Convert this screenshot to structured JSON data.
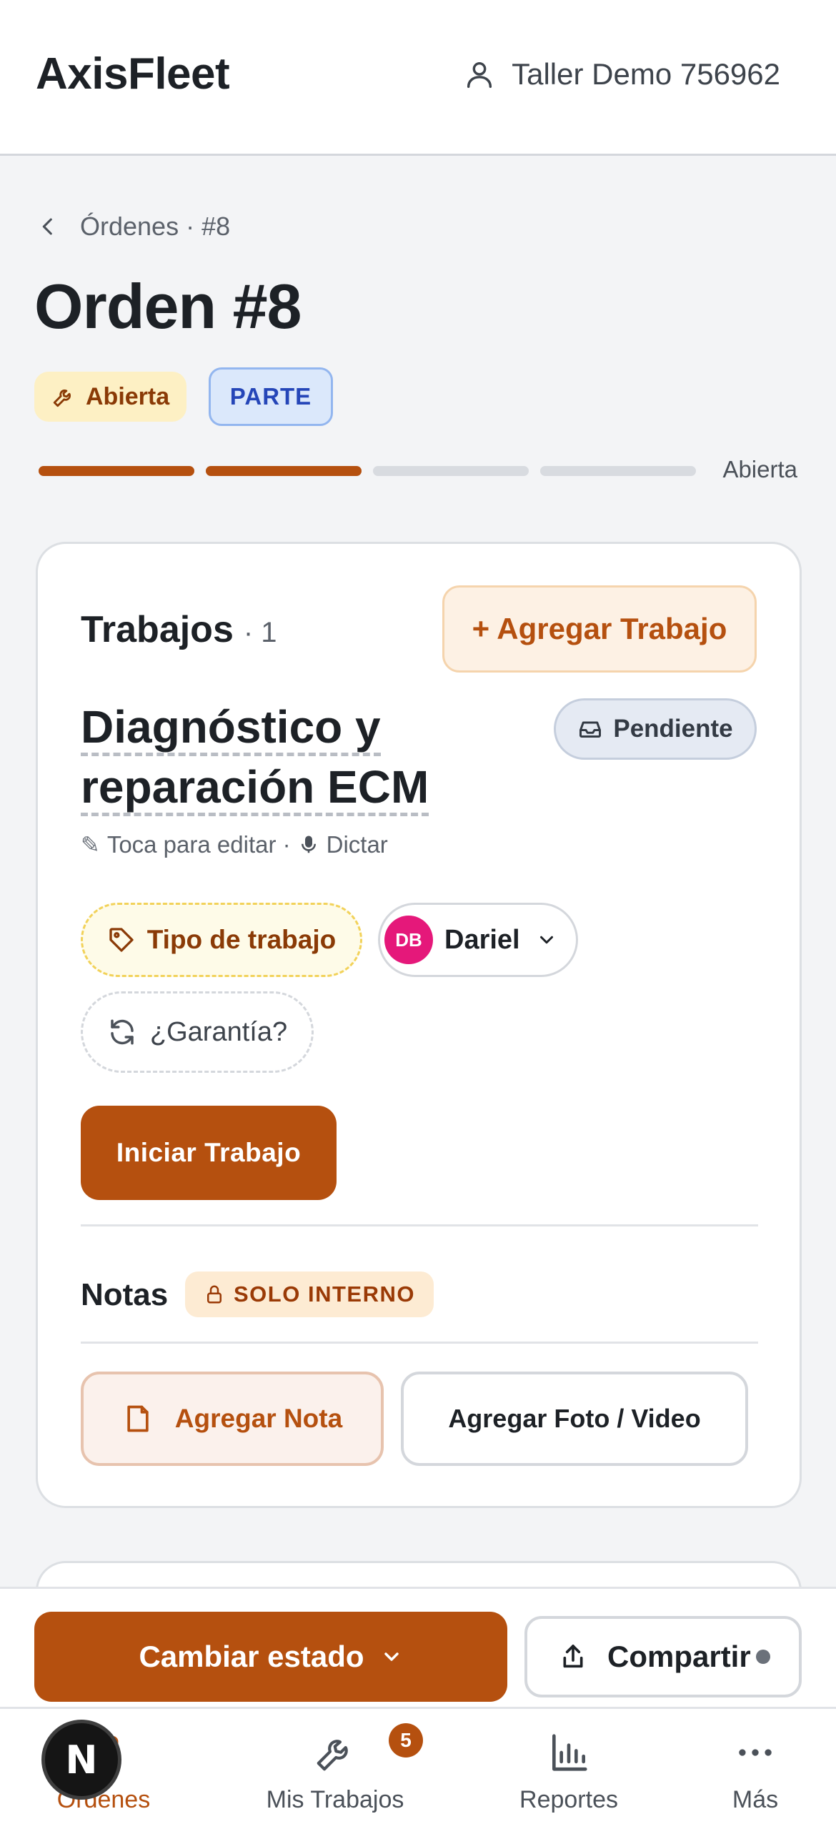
{
  "header": {
    "brand": "AxisFleet",
    "user_name": "Taller Demo 756962",
    "icons": {
      "user": "user-icon"
    }
  },
  "breadcrumb": {
    "text": "Órdenes · #8",
    "back_icon": "chevron-left-icon"
  },
  "order": {
    "title": "Orden #8",
    "status_badge": "Abierta",
    "type_badge": "PARTE",
    "progress": {
      "completed_steps": 2,
      "total_steps": 4,
      "label": "Abierta"
    }
  },
  "jobs": {
    "heading": "Trabajos",
    "count": "· 1",
    "add_button": "+ Agregar Trabajo",
    "item": {
      "title": "Diagnóstico y reparación ECM",
      "status": "Pendiente",
      "hint_edit": "Toca para editar ·",
      "hint_dictate": "Dictar",
      "job_type_label": "Tipo de trabajo",
      "assignee_initials": "DB",
      "assignee_name": "Dariel",
      "warranty_label": "¿Garantía?",
      "start_button": "Iniciar Trabajo"
    },
    "notes": {
      "heading": "Notas",
      "internal_badge": "SOLO INTERNO",
      "add_note_button": "Agregar Nota",
      "add_media_button": "Agregar Foto / Video"
    }
  },
  "actions": {
    "change_status": "Cambiar estado",
    "share": "Compartir"
  },
  "tabbar": {
    "tabs": [
      {
        "label": "Órdenes",
        "icon": "clipboard-icon",
        "active": true
      },
      {
        "label": "Mis Trabajos",
        "icon": "wrench-icon",
        "badge": "5"
      },
      {
        "label": "Reportes",
        "icon": "bar-chart-icon"
      },
      {
        "label": "Más",
        "icon": "more-horizontal-icon"
      }
    ]
  },
  "floating_button": {
    "text": "N"
  },
  "colors": {
    "accent": "#b5500f",
    "background": "#f3f4f6",
    "avatar": "#e5187a",
    "open_badge_bg": "#fdf0c4",
    "parte_badge_bg": "#dbe8fb"
  }
}
